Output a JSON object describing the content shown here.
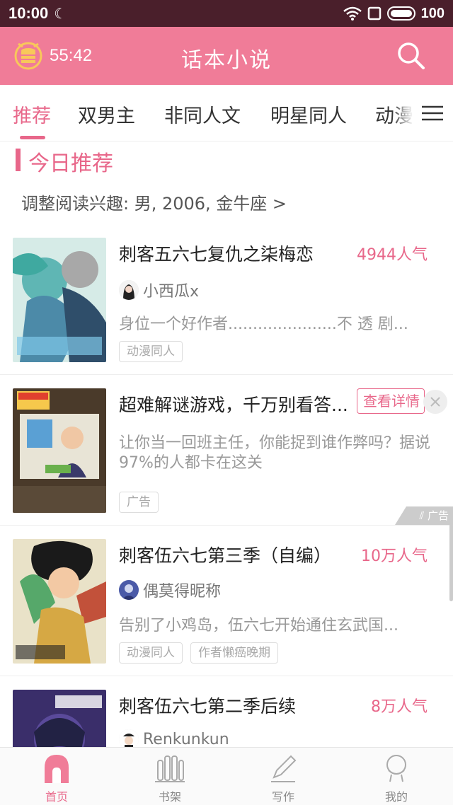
{
  "status": {
    "time": "10:00",
    "battery": "100",
    "battery_level": 1.0
  },
  "header": {
    "timer": "55:42",
    "title": "话本小说"
  },
  "tabs": [
    {
      "label": "推荐"
    },
    {
      "label": "双男主"
    },
    {
      "label": "非同人文"
    },
    {
      "label": "明星同人"
    },
    {
      "label": "动漫同人"
    }
  ],
  "section": {
    "title": "今日推荐",
    "interest": "调整阅读兴趣: 男, 2006, 金牛座 >"
  },
  "cards": [
    {
      "title": "刺客五六七复仇之柒梅恋",
      "popularity": "4944人气",
      "author": "小西瓜x",
      "desc": "身位一个好作者......................不  透  剧...",
      "tags": [
        "动漫同人"
      ]
    },
    {
      "title": "刺客伍六七第三季（自编）",
      "popularity": "10万人气",
      "author": "偶莫得昵称",
      "desc": "告别了小鸡岛，伍六七开始通住玄武国...",
      "tags": [
        "动漫同人",
        "作者懒癌晚期"
      ]
    },
    {
      "title": "刺客伍六七第二季后续",
      "popularity": "8万人气",
      "author": "Renkunkun"
    }
  ],
  "ad": {
    "title": "超难解谜游戏，千万别看答...",
    "detail_button": "查看详情",
    "desc": "让你当一回班主任，你能捉到谁作弊吗？据说97%的人都卡在这关",
    "tag": "广告",
    "mark": "广告"
  },
  "nav": [
    {
      "label": "首页",
      "icon": "home-icon"
    },
    {
      "label": "书架",
      "icon": "bookshelf-icon"
    },
    {
      "label": "写作",
      "icon": "pen-icon"
    },
    {
      "label": "我的",
      "icon": "profile-icon"
    }
  ],
  "colors": {
    "accent": "#e8678a",
    "header": "#f07c98",
    "statusbar": "#4a1f2b"
  }
}
